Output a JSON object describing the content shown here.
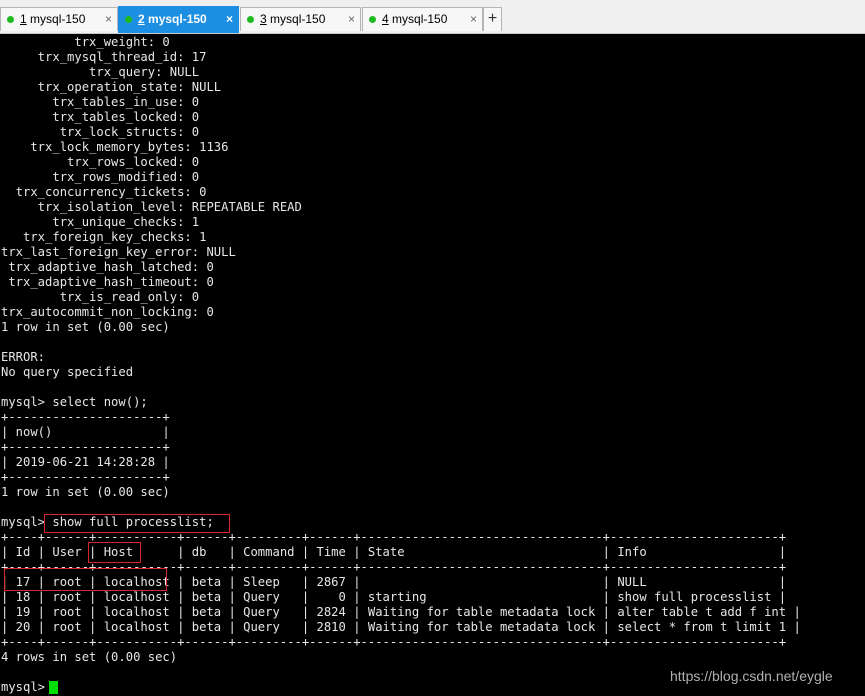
{
  "tabs": [
    {
      "number": "1",
      "title": "mysql-150",
      "active": false
    },
    {
      "number": "2",
      "title": "mysql-150",
      "active": true
    },
    {
      "number": "3",
      "title": "mysql-150",
      "active": false
    },
    {
      "number": "4",
      "title": "mysql-150",
      "active": false
    }
  ],
  "tab_close_glyph": "×",
  "new_tab_glyph": "+",
  "colors": {
    "active_tab": "#1c8fe3",
    "status_dot": "#1fba1f",
    "highlight_box": "#d9262a",
    "cursor": "#00e000"
  },
  "terminal": {
    "lines": [
      "          trx_weight: 0",
      "     trx_mysql_thread_id: 17",
      "            trx_query: NULL",
      "     trx_operation_state: NULL",
      "       trx_tables_in_use: 0",
      "       trx_tables_locked: 0",
      "        trx_lock_structs: 0",
      "    trx_lock_memory_bytes: 1136",
      "         trx_rows_locked: 0",
      "       trx_rows_modified: 0",
      "  trx_concurrency_tickets: 0",
      "     trx_isolation_level: REPEATABLE READ",
      "       trx_unique_checks: 1",
      "   trx_foreign_key_checks: 1",
      "trx_last_foreign_key_error: NULL",
      " trx_adaptive_hash_latched: 0",
      " trx_adaptive_hash_timeout: 0",
      "        trx_is_read_only: 0",
      "trx_autocommit_non_locking: 0",
      "1 row in set (0.00 sec)",
      "",
      "ERROR:",
      "No query specified",
      "",
      "mysql> select now();",
      "+---------------------+",
      "| now()               |",
      "+---------------------+",
      "| 2019-06-21 14:28:28 |",
      "+---------------------+",
      "1 row in set (0.00 sec)",
      "",
      "mysql> show full processlist;",
      "+----+------+-----------+------+---------+------+---------------------------------+-----------------------+",
      "| Id | User | Host      | db   | Command | Time | State                           | Info                  |",
      "+----+------+-----------+------+---------+------+---------------------------------+-----------------------+",
      "| 17 | root | localhost | beta | Sleep   | 2867 |                                 | NULL                  |",
      "| 18 | root | localhost | beta | Query   |    0 | starting                        | show full processlist |",
      "| 19 | root | localhost | beta | Query   | 2824 | Waiting for table metadata lock | alter table t add f int |",
      "| 20 | root | localhost | beta | Query   | 2810 | Waiting for table metadata lock | select * from t limit 1 |",
      "+----+------+-----------+------+---------+------+---------------------------------+-----------------------+",
      "4 rows in set (0.00 sec)",
      "",
      "mysql> "
    ]
  },
  "watermark": "https://blog.csdn.net/eygle"
}
